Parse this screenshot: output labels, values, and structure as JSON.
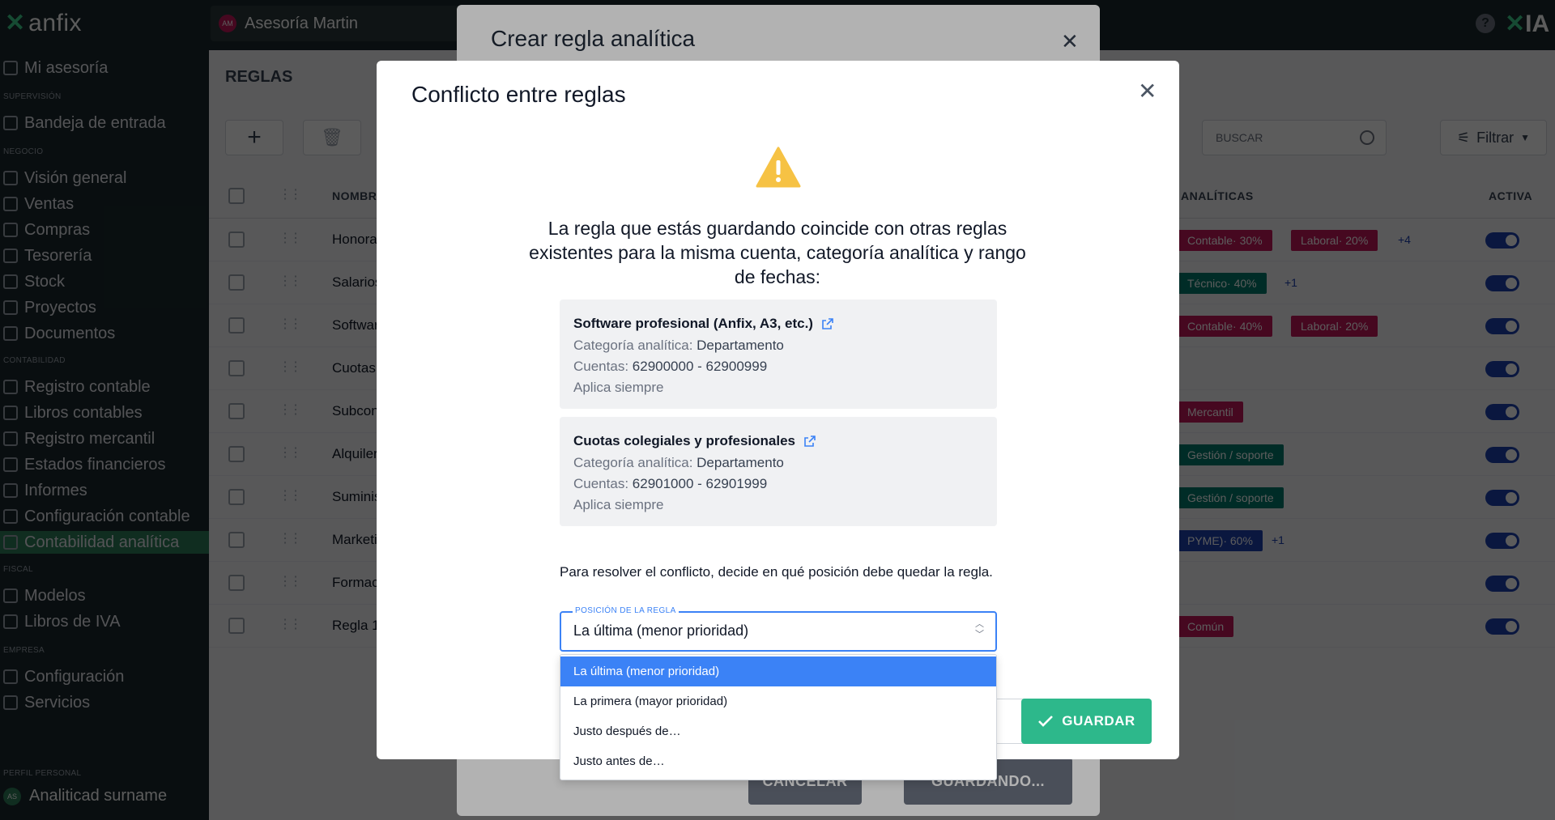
{
  "app": {
    "logo_text": "anfix",
    "company_name": "Asesoría Martin",
    "company_initials": "AM",
    "ia_label": "IA",
    "help_symbol": "?"
  },
  "sidebar": {
    "my_office": "Mi asesoría",
    "sections": {
      "supervision": "SUPERVISIÓN",
      "business": "NEGOCIO",
      "accounting": "CONTABILIDAD",
      "fiscal": "FISCAL",
      "company": "EMPRESA",
      "profile": "PERFIL PERSONAL"
    },
    "items": {
      "inbox": "Bandeja de entrada",
      "overview": "Visión general",
      "sales": "Ventas",
      "purchases": "Compras",
      "treasury": "Tesorería",
      "stock": "Stock",
      "projects": "Proyectos",
      "documents": "Documentos",
      "ledger_entry": "Registro contable",
      "books": "Libros contables",
      "mercantile": "Registro mercantil",
      "financials": "Estados financieros",
      "reports": "Informes",
      "acc_config": "Configuración contable",
      "analytics": "Contabilidad analítica",
      "models": "Modelos",
      "vat_books": "Libros de IVA",
      "config": "Configuración",
      "services": "Servicios"
    },
    "profile_name": "Analiticad surname",
    "profile_initials": "AS"
  },
  "main": {
    "title": "REGLAS",
    "search_placeholder": "BUSCAR",
    "filter_label": "Filtrar",
    "columns": {
      "name": "NOMBRE",
      "analytics": "ANALÍTICAS",
      "active": "ACTIVA"
    },
    "rows": [
      {
        "name": "Honorarios profesionales",
        "tags": [
          {
            "text": "Contable· 30%",
            "color": "pink"
          },
          {
            "text": "Laboral· 20%",
            "color": "pink"
          }
        ],
        "more": "+4"
      },
      {
        "name": "Salarios",
        "tags": [
          {
            "text": "Técnico· 40%",
            "color": "teal"
          }
        ],
        "more": "+1"
      },
      {
        "name": "Software profesional",
        "tags": [
          {
            "text": "Contable· 40%",
            "color": "pink"
          },
          {
            "text": "Laboral· 20%",
            "color": "pink"
          }
        ],
        "more": ""
      },
      {
        "name": "Cuotas colegiales",
        "tags": [],
        "more": ""
      },
      {
        "name": "Subcontratación",
        "tags": [
          {
            "text": "Mercantil",
            "color": "pink"
          }
        ],
        "more": ""
      },
      {
        "name": "Alquiler",
        "tags": [
          {
            "text": "Gestión / soporte",
            "color": "teal"
          }
        ],
        "more": ""
      },
      {
        "name": "Suministros",
        "tags": [
          {
            "text": "Gestión / soporte",
            "color": "teal"
          }
        ],
        "more": ""
      },
      {
        "name": "Marketing",
        "tags": [
          {
            "text": "PYME)· 60%",
            "color": "blue"
          }
        ],
        "more": "+1"
      },
      {
        "name": "Formación",
        "tags": [],
        "more": ""
      },
      {
        "name": "Regla 1",
        "tags": [
          {
            "text": "Común",
            "color": "pink"
          }
        ],
        "more": ""
      }
    ]
  },
  "create_modal": {
    "title": "Crear regla analítica",
    "cancel_label": "CANCELAR",
    "saving_label": "GUARDANDO..."
  },
  "conflict_modal": {
    "title": "Conflicto entre reglas",
    "intro": "La regla que estás guardando coincide con otras reglas existentes para la misma cuenta, categoría analítica y rango de fechas:",
    "rules": [
      {
        "name": "Software profesional (Anfix, A3, etc.)",
        "category_label": "Categoría analítica:",
        "category_value": "Departamento",
        "accounts_label": "Cuentas:",
        "accounts_value": "62900000 - 62900999",
        "applies": "Aplica siempre"
      },
      {
        "name": "Cuotas colegiales y profesionales",
        "category_label": "Categoría analítica:",
        "category_value": "Departamento",
        "accounts_label": "Cuentas:",
        "accounts_value": "62901000 - 62901999",
        "applies": "Aplica siempre"
      }
    ],
    "resolve_text": "Para resolver el conflicto, decide en qué posición debe quedar la regla.",
    "select_label": "POSICIÓN DE LA REGLA",
    "select_value": "La última (menor prioridad)",
    "options": [
      "La última (menor prioridad)",
      "La primera (mayor prioridad)",
      "Justo después de…",
      "Justo antes de…"
    ],
    "selected_index": 0,
    "save_label": "GUARDAR"
  },
  "colors": {
    "brand_green": "#3ecf8e",
    "sidebar_bg": "#1a2a2c",
    "active_nav": "#2e7d5b",
    "save_button": "#2db88b",
    "focus_blue": "#3b82f6",
    "tag_pink": "#c2185b",
    "tag_teal": "#00796b",
    "tag_blue": "#1e40af",
    "warning_yellow": "#f6c244"
  },
  "icons": [
    "warning-icon",
    "close-icon",
    "external-link-icon",
    "check-icon",
    "search-icon",
    "filter-icon",
    "plus-icon",
    "trash-icon",
    "help-icon"
  ]
}
